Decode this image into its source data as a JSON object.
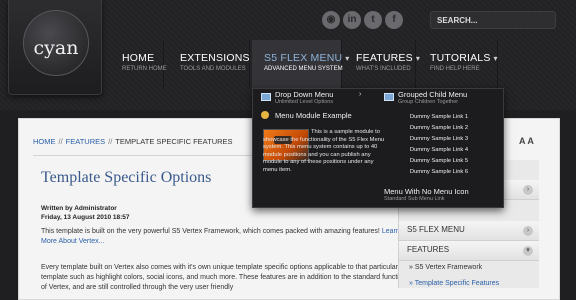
{
  "logo": {
    "text": "cyan"
  },
  "social_icons": [
    "rss-icon",
    "linkedin-icon",
    "twitter-icon",
    "facebook-icon"
  ],
  "search": {
    "placeholder": "SEARCH..."
  },
  "nav": [
    {
      "title": "HOME",
      "sub": "RETURN HOME",
      "chevron": false,
      "active": false
    },
    {
      "title": "EXTENSIONS",
      "sub": "TOOLS AND MODULES",
      "chevron": true,
      "active": false
    },
    {
      "title": "S5 FLEX MENU",
      "sub": "ADVANCED MENU SYSTEM",
      "chevron": true,
      "active": true
    },
    {
      "title": "FEATURES",
      "sub": "WHAT'S INCLUDED",
      "chevron": true,
      "active": false
    },
    {
      "title": "TUTORIALS",
      "sub": "FIND HELP HERE",
      "chevron": true,
      "active": false
    }
  ],
  "dropdown": {
    "drop_down_menu": {
      "title": "Drop Down Menu",
      "sub": "Unlimited Level Options"
    },
    "menu_module": {
      "title": "Menu Module Example"
    },
    "module_text": "This is a sample module to showcase the functionality of the S5 Flex Menu system. This menu system contains up to 40 module positions and you can publish any module to any of these positions under any menu item.",
    "grouped_child": {
      "title": "Grouped Child Menu",
      "sub": "Group Children Together"
    },
    "sample_links": [
      "Dummy Sample Link 1",
      "Dummy Sample Link 2",
      "Dummy Sample Link 3",
      "Dummy Sample Link 4",
      "Dummy Sample Link 5",
      "Dummy Sample Link 6"
    ],
    "no_icon": {
      "title": "Menu With No Menu Icon",
      "sub": "Standard Sub Menu Link"
    }
  },
  "breadcrumb": {
    "home": "HOME",
    "sep": "//",
    "features": "FEATURES",
    "current": "TEMPLATE SPECIFIC FEATURES"
  },
  "font_resize": "A A",
  "article": {
    "title": "Template Specific Options",
    "author": "Written by Administrator",
    "date": "Friday, 13 August 2010 18:57",
    "p1": "This template is built on the very powerful S5 Vertex Framework, which comes packed with amazing features!",
    "p1_link": "Learn More About Vertex...",
    "p2": "Every template built on Vertex also comes with it's own unique template specific options applicable to that particular template such as highlight colors, social icons, and much more. These features are in addition to the standard functions of Vertex, and are still controlled through the very user friendly"
  },
  "sidebar": {
    "items": [
      "S5 FLEX MENU",
      "FEATURES"
    ],
    "subitems": [
      "S5 Vertex Framework",
      "Template Specific Features"
    ]
  },
  "colors": {
    "accent": "#8fb2da",
    "link": "#2a5fa8",
    "title": "#3a5a8c"
  }
}
